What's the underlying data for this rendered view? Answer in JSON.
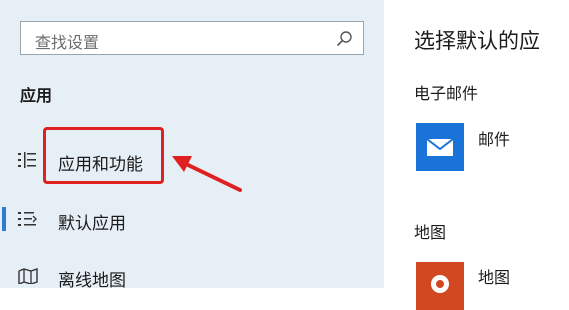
{
  "search": {
    "placeholder": "查找设置"
  },
  "sidebar": {
    "section_title": "应用",
    "items": [
      {
        "label": "应用和功能",
        "icon": "apps-features-icon"
      },
      {
        "label": "默认应用",
        "icon": "default-apps-icon",
        "selected": true
      },
      {
        "label": "离线地图",
        "icon": "offline-maps-icon"
      }
    ]
  },
  "main": {
    "title": "选择默认的应",
    "categories": [
      {
        "label": "电子邮件",
        "app": "邮件",
        "icon": "mail-icon"
      },
      {
        "label": "地图",
        "app": "地图",
        "icon": "maps-icon"
      }
    ]
  },
  "colors": {
    "sidebar_bg": "#e6eef6",
    "accent": "#2e7bd1",
    "annotation_red": "#e02020",
    "mail_tile": "#1a73d8",
    "maps_tile": "#d1471f"
  }
}
